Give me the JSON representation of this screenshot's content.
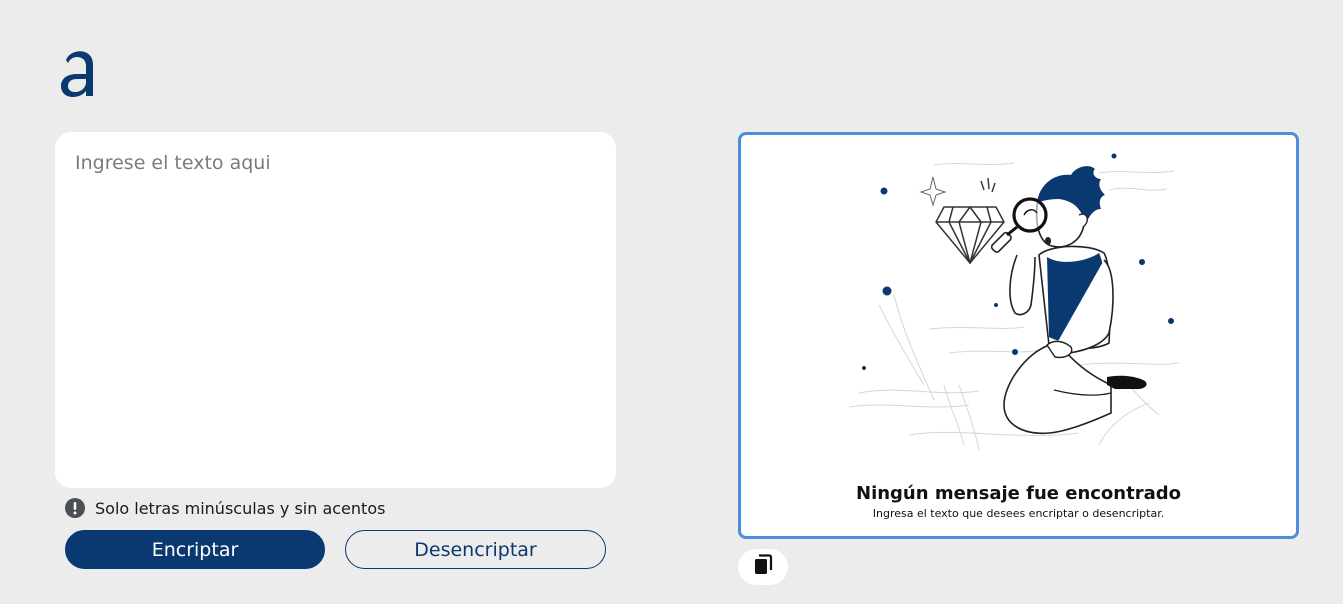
{
  "app": {
    "logo_icon": "alura-a-logo"
  },
  "input": {
    "placeholder": "Ingrese el texto aqui",
    "value": ""
  },
  "warning": {
    "icon": "exclamation-circle-icon",
    "text": "Solo letras minúsculas y sin acentos"
  },
  "buttons": {
    "encrypt_label": "Encriptar",
    "decrypt_label": "Desencriptar"
  },
  "output": {
    "illustration": "person-with-magnifying-glass-and-diamond",
    "title": "Ningún mensaje fue encontrado",
    "subtitle": "Ingresa el texto que desees encriptar o desencriptar.",
    "copy_icon": "copy-icon"
  },
  "colors": {
    "background": "#ececec",
    "primary": "#0a3871",
    "panel_border": "#4a8fd8",
    "card": "#ffffff"
  }
}
